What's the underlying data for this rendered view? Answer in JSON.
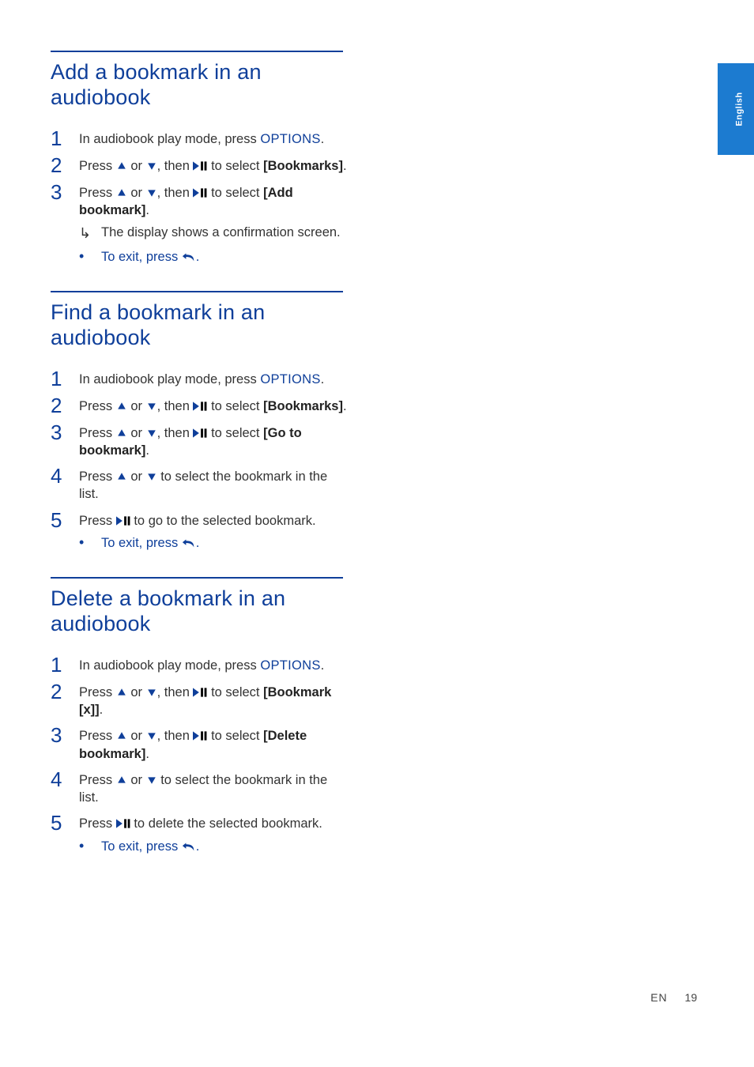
{
  "sideTab": "English",
  "footer": {
    "lang": "EN",
    "page": "19"
  },
  "icons": {
    "up": "▲",
    "down": "▼",
    "playpause": "▶Ⅱ",
    "back": "↶"
  },
  "sections": [
    {
      "title": "Add a bookmark in an audiobook",
      "steps": [
        {
          "num": "1",
          "parts": [
            {
              "t": "In audiobook play mode, press "
            },
            {
              "t": "OPTIONS",
              "cls": "opt"
            },
            {
              "t": "."
            }
          ]
        },
        {
          "num": "2",
          "parts": [
            {
              "t": "Press "
            },
            {
              "icon": "up"
            },
            {
              "t": " or "
            },
            {
              "icon": "down"
            },
            {
              "t": ", then "
            },
            {
              "icon": "playpause"
            },
            {
              "t": " to select "
            },
            {
              "t": "[Bookmarks]",
              "cls": "bold"
            },
            {
              "t": "."
            }
          ]
        },
        {
          "num": "3",
          "parts": [
            {
              "t": "Press "
            },
            {
              "icon": "up"
            },
            {
              "t": " or "
            },
            {
              "icon": "down"
            },
            {
              "t": ", then "
            },
            {
              "icon": "playpause"
            },
            {
              "t": " to select "
            },
            {
              "t": "[Add bookmark]",
              "cls": "bold"
            },
            {
              "t": "."
            }
          ],
          "subs": [
            {
              "marker": "arrow",
              "parts": [
                {
                  "t": "The display shows a confirmation screen."
                }
              ]
            },
            {
              "marker": "bullet",
              "parts": [
                {
                  "t": "To exit, press ",
                  "cls": "opt-text"
                },
                {
                  "icon": "back"
                },
                {
                  "t": ".",
                  "cls": "opt-text"
                }
              ],
              "color": "blue"
            }
          ]
        }
      ]
    },
    {
      "title": "Find a bookmark in an audiobook",
      "steps": [
        {
          "num": "1",
          "parts": [
            {
              "t": "In audiobook play mode, press "
            },
            {
              "t": "OPTIONS",
              "cls": "opt"
            },
            {
              "t": "."
            }
          ]
        },
        {
          "num": "2",
          "parts": [
            {
              "t": "Press "
            },
            {
              "icon": "up"
            },
            {
              "t": " or "
            },
            {
              "icon": "down"
            },
            {
              "t": ", then "
            },
            {
              "icon": "playpause"
            },
            {
              "t": " to select "
            },
            {
              "t": "[Bookmarks]",
              "cls": "bold"
            },
            {
              "t": "."
            }
          ]
        },
        {
          "num": "3",
          "parts": [
            {
              "t": "Press "
            },
            {
              "icon": "up"
            },
            {
              "t": " or "
            },
            {
              "icon": "down"
            },
            {
              "t": ", then "
            },
            {
              "icon": "playpause"
            },
            {
              "t": " to select "
            },
            {
              "t": "[Go to bookmark]",
              "cls": "bold"
            },
            {
              "t": "."
            }
          ]
        },
        {
          "num": "4",
          "parts": [
            {
              "t": "Press "
            },
            {
              "icon": "up"
            },
            {
              "t": " or "
            },
            {
              "icon": "down"
            },
            {
              "t": " to select the bookmark in the list."
            }
          ]
        },
        {
          "num": "5",
          "parts": [
            {
              "t": "Press "
            },
            {
              "icon": "playpause"
            },
            {
              "t": " to go to the selected bookmark."
            }
          ],
          "subs": [
            {
              "marker": "bullet",
              "parts": [
                {
                  "t": "To exit, press "
                },
                {
                  "icon": "back"
                },
                {
                  "t": "."
                }
              ],
              "color": "blue"
            }
          ]
        }
      ]
    },
    {
      "title": "Delete a bookmark in an audiobook",
      "steps": [
        {
          "num": "1",
          "parts": [
            {
              "t": "In audiobook play mode, press "
            },
            {
              "t": "OPTIONS",
              "cls": "opt"
            },
            {
              "t": "."
            }
          ]
        },
        {
          "num": "2",
          "parts": [
            {
              "t": "Press "
            },
            {
              "icon": "up"
            },
            {
              "t": " or "
            },
            {
              "icon": "down"
            },
            {
              "t": ", then "
            },
            {
              "icon": "playpause"
            },
            {
              "t": " to select "
            },
            {
              "t": "[Bookmark [x]]",
              "cls": "bold"
            },
            {
              "t": "."
            }
          ]
        },
        {
          "num": "3",
          "parts": [
            {
              "t": "Press "
            },
            {
              "icon": "up"
            },
            {
              "t": " or "
            },
            {
              "icon": "down"
            },
            {
              "t": ", then "
            },
            {
              "icon": "playpause"
            },
            {
              "t": " to select "
            },
            {
              "t": "[Delete bookmark]",
              "cls": "bold"
            },
            {
              "t": "."
            }
          ]
        },
        {
          "num": "4",
          "parts": [
            {
              "t": "Press "
            },
            {
              "icon": "up"
            },
            {
              "t": " or "
            },
            {
              "icon": "down"
            },
            {
              "t": " to select the bookmark in the list."
            }
          ]
        },
        {
          "num": "5",
          "parts": [
            {
              "t": "Press "
            },
            {
              "icon": "playpause"
            },
            {
              "t": " to delete the selected bookmark."
            }
          ],
          "subs": [
            {
              "marker": "bullet",
              "parts": [
                {
                  "t": "To exit, press "
                },
                {
                  "icon": "back"
                },
                {
                  "t": "."
                }
              ],
              "color": "blue"
            }
          ]
        }
      ]
    }
  ]
}
